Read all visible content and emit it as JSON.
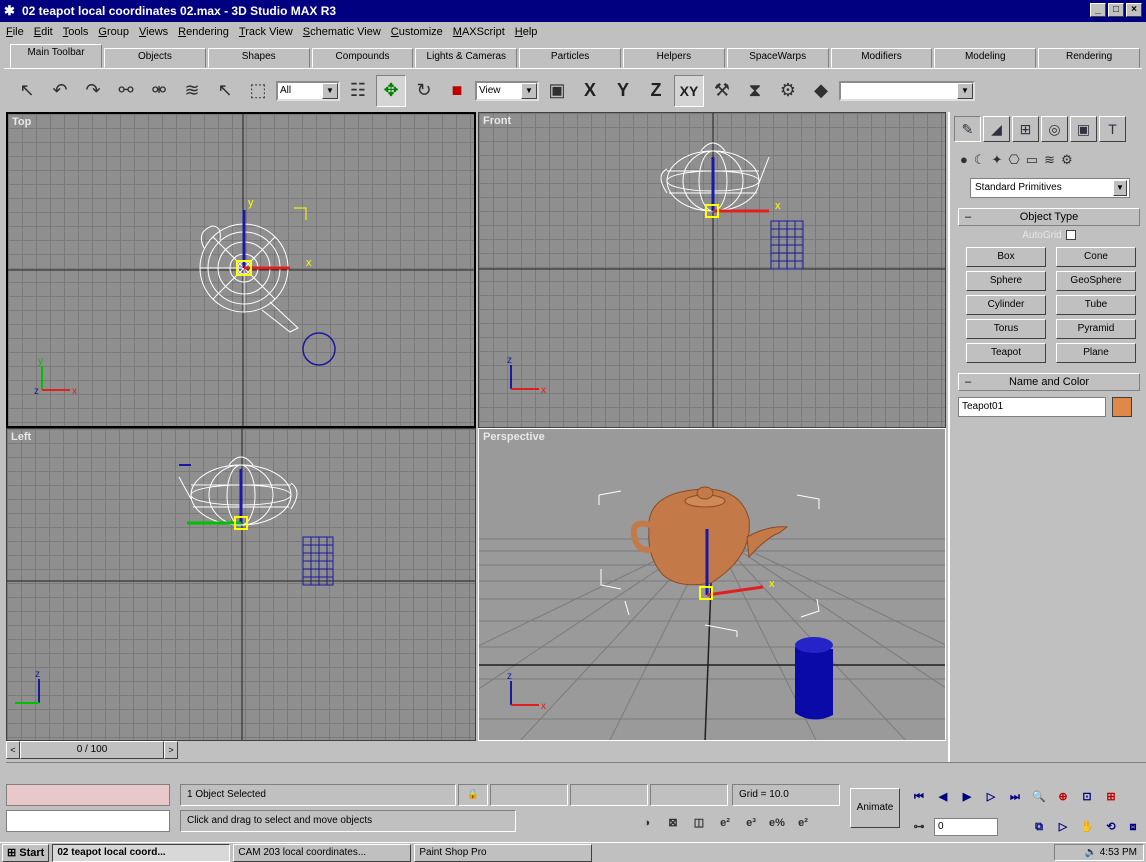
{
  "window": {
    "title": "02 teapot local coordinates 02.max - 3D Studio MAX R3",
    "buttons": [
      "_",
      "□",
      "×"
    ]
  },
  "menu": [
    "File",
    "Edit",
    "Tools",
    "Group",
    "Views",
    "Rendering",
    "Track View",
    "Schematic View",
    "Customize",
    "MAXScript",
    "Help"
  ],
  "tabs": [
    "Main Toolbar",
    "Objects",
    "Shapes",
    "Compounds",
    "Lights & Cameras",
    "Particles",
    "Helpers",
    "SpaceWarps",
    "Modifiers",
    "Modeling",
    "Rendering"
  ],
  "toolbar": {
    "selection_filter": "All",
    "coord_system": "View",
    "axis_x": "X",
    "axis_y": "Y",
    "axis_z": "Z",
    "axis_xy": "XY",
    "named_selection": ""
  },
  "viewports": {
    "top": "Top",
    "front": "Front",
    "left": "Left",
    "perspective": "Perspective"
  },
  "command_panel": {
    "category": "Standard Primitives",
    "object_type_title": "Object Type",
    "autogrid": "AutoGrid",
    "buttons": [
      "Box",
      "Cone",
      "Sphere",
      "GeoSphere",
      "Cylinder",
      "Tube",
      "Torus",
      "Pyramid",
      "Teapot",
      "Plane"
    ],
    "name_color_title": "Name and Color",
    "object_name": "Teapot01",
    "object_color": "#e08848"
  },
  "time_slider": {
    "position": "0 / 100"
  },
  "status": {
    "selection": "1 Object Selected",
    "prompt": "Click and drag to select and move objects",
    "grid": "Grid = 10.0",
    "animate": "Animate",
    "frame": "0"
  },
  "taskbar": {
    "start": "Start",
    "tasks": [
      "02 teapot local coord...",
      "CAM 203 local coordinates...",
      "Paint Shop Pro"
    ],
    "clock": "4:53 PM"
  },
  "colors": {
    "title_bar": "#000080",
    "viewport_bg": "#8f8f8f",
    "teapot_shaded": "#c47a48",
    "helper_blue": "#1a1aa0"
  }
}
